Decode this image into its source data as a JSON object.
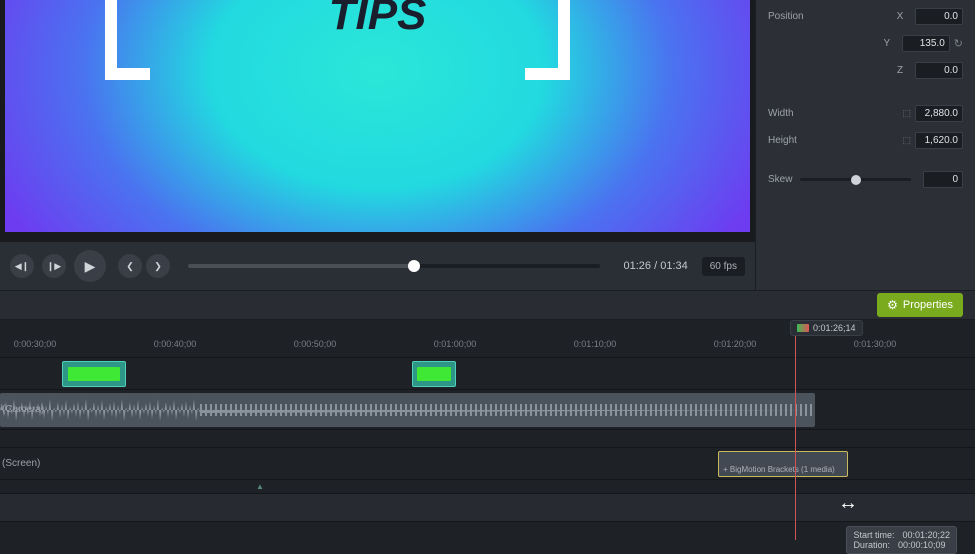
{
  "preview": {
    "title_text": "TIPS"
  },
  "playbar": {
    "timecode": "01:26 / 01:34",
    "fps": "60 fps"
  },
  "properties": {
    "position_label": "Position",
    "x_label": "X",
    "y_label": "Y",
    "z_label": "Z",
    "x_val": "0.0",
    "y_val": "135.0",
    "z_val": "0.0",
    "width_label": "Width",
    "height_label": "Height",
    "width_val": "2,880.0",
    "height_val": "1,620.0",
    "skew_label": "Skew",
    "skew_val": "0"
  },
  "props_button": "Properties",
  "playhead_time": "0:01:26;14",
  "ruler": [
    {
      "label": "0:00:30;00",
      "pos": 35
    },
    {
      "label": "0:00:40;00",
      "pos": 175
    },
    {
      "label": "0:00:50;00",
      "pos": 315
    },
    {
      "label": "0:01:00;00",
      "pos": 455
    },
    {
      "label": "0:01:10;00",
      "pos": 595
    },
    {
      "label": "0:01:20;00",
      "pos": 735
    },
    {
      "label": "0:01:30;00",
      "pos": 875
    }
  ],
  "tracks": {
    "camera": "(Camera)",
    "screen": "(Screen)"
  },
  "motion_clip": "+  BigMotion Brackets  (1 media)",
  "tooltip": {
    "start_label": "Start time:",
    "start_val": "00:01:20;22",
    "dur_label": "Duration:",
    "dur_val": "00:00:10;09"
  }
}
